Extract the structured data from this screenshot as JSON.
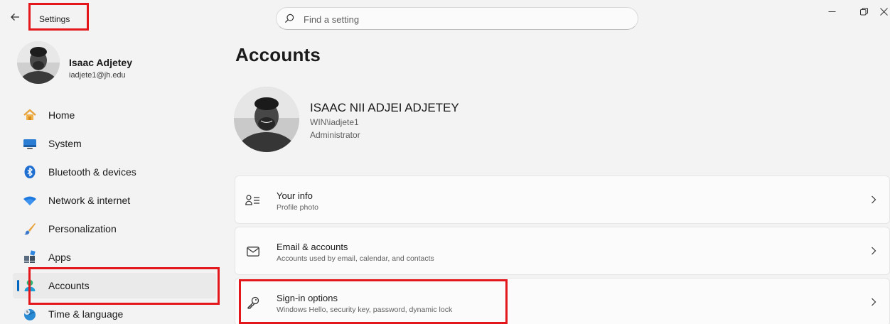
{
  "titlebar": {
    "app_title": "Settings",
    "search_placeholder": "Find a setting"
  },
  "user": {
    "name": "Isaac Adjetey",
    "email": "iadjete1@jh.edu"
  },
  "nav": {
    "items": [
      {
        "label": "Home",
        "icon": "home-icon"
      },
      {
        "label": "System",
        "icon": "system-icon"
      },
      {
        "label": "Bluetooth & devices",
        "icon": "bluetooth-icon"
      },
      {
        "label": "Network & internet",
        "icon": "wifi-icon"
      },
      {
        "label": "Personalization",
        "icon": "brush-icon"
      },
      {
        "label": "Apps",
        "icon": "apps-icon"
      },
      {
        "label": "Accounts",
        "icon": "person-icon",
        "active": true
      },
      {
        "label": "Time & language",
        "icon": "globe-clock-icon"
      }
    ]
  },
  "main": {
    "title": "Accounts",
    "profile": {
      "name": "ISAAC NII ADJEI ADJETEY",
      "account": "WIN\\iadjete1",
      "role": "Administrator"
    },
    "cards": [
      {
        "title": "Your info",
        "subtitle": "Profile photo",
        "icon": "person-list-icon"
      },
      {
        "title": "Email & accounts",
        "subtitle": "Accounts used by email, calendar, and contacts",
        "icon": "mail-icon"
      },
      {
        "title": "Sign-in options",
        "subtitle": "Windows Hello, security key, password, dynamic lock",
        "icon": "key-icon"
      }
    ]
  },
  "colors": {
    "accent": "#0067c0",
    "highlight": "#e3161b",
    "background": "#f3f3f3",
    "card": "#fbfbfb"
  }
}
